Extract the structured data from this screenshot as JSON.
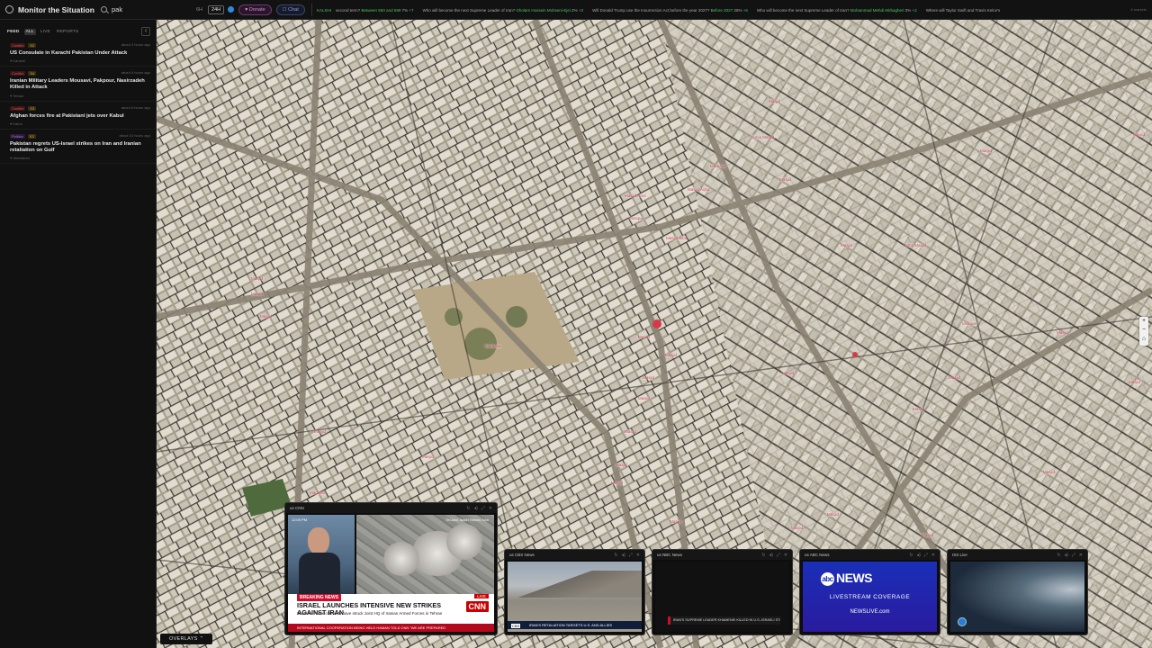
{
  "app": {
    "title": "Monitor the Situation"
  },
  "search": {
    "value": "pak",
    "placeholder": ""
  },
  "toggles": [
    {
      "label": "6H",
      "on": false
    },
    {
      "label": "24H",
      "on": true
    }
  ],
  "buttons": {
    "donate": "♥ Donate",
    "chat": "☐ Chat"
  },
  "ticker": {
    "label": "KALSHI",
    "items": [
      {
        "text": "second term?",
        "extra": "Between 550 and 599",
        "pct": "7%",
        "delta": "+7"
      },
      {
        "text": "Who will become the next Supreme Leader of Iran?",
        "extra": "Gholam Hossein Mohseni-Ejei",
        "pct": "2%",
        "delta": "+2"
      },
      {
        "text": "Will Donald Trump use the Insurrection Act before the year 2027?",
        "extra": "Before 2027",
        "pct": "28%",
        "delta": "+6"
      },
      {
        "text": "Who will become the next Supreme Leader of Iran?",
        "extra": "Mohammad Mehdi Mirbagheri",
        "pct": "3%",
        "delta": "+2"
      },
      {
        "text": "Where will Taylor Swift and Travis Kelce's",
        "extra": "",
        "pct": "",
        "delta": ""
      }
    ],
    "more": "6 markets"
  },
  "sidebar": {
    "tabs": [
      "FEED",
      "ALL",
      "LIVE",
      "REPORTS"
    ],
    "active_tab": "ALL",
    "items": [
      {
        "category": "Conflict",
        "severity": "S2",
        "time": "about 3 hours ago",
        "title": "US Consulate in Karachi Pakistan Under Attack",
        "location": "Karachi"
      },
      {
        "category": "Conflict",
        "severity": "S4",
        "time": "about 4 hours ago",
        "title": "Iranian Military Leaders Mousavi, Pakpour, Nasirzadeh Killed in Attack",
        "location": "Tehran"
      },
      {
        "category": "Conflict",
        "severity": "S3",
        "time": "about 6 hours ago",
        "title": "Afghan forces fire at Pakistani jets over Kabul",
        "location": "Kabul"
      },
      {
        "category": "Politics",
        "severity": "S3",
        "time": "about 10 hours ago",
        "title": "Pakistan regrets US-Israel strikes on Iran and Iranian retaliation on Gulf",
        "location": "Islamabad"
      }
    ]
  },
  "map": {
    "labels": [
      "Masjid",
      "Jamia Masjid",
      "Madrasa",
      "Masjid Noor",
      "Masjid Aqsa",
      "Masjid",
      "Mosque",
      "Masjid Bilal",
      "Masjid",
      "Jama Masjid",
      "Masjid",
      "Masjid",
      "Masjid",
      "Madrasa",
      "Masjid",
      "Masjid",
      "Masjid",
      "Masjid",
      "Masjid",
      "Mosque",
      "Masjid",
      "Masjid",
      "Masjid",
      "Masjid",
      "Masjid",
      "Masjid",
      "Masjid",
      "Masjid",
      "Masjid",
      "Masjid",
      "Masjid",
      "Masjid",
      "Masjid",
      "Masjid",
      "Masjid",
      "Masjid",
      "Madrasa"
    ],
    "zoom": [
      "+",
      "−",
      "⌂"
    ],
    "overlays_button": "OVERLAYS ⌃"
  },
  "videos": [
    {
      "id": "cnn",
      "title": "us CNN",
      "time": "12:09 PM",
      "loc_top": "Tel Aviv, Israel",
      "loc_right": "Tehran, Iran",
      "breaking": "BREAKING NEWS",
      "live": "LIVE",
      "headline": "ISRAEL LAUNCHES INTENSIVE NEW STRIKES AGAINST IRAN",
      "sub": "Israel Air Force claims to have struck Joint HQ of Iranian Armed Forces in Tehran",
      "crawl": "INTERNATIONAL COOPERATION BEING HELD HAMAN TOLD CNN \"WE ARE PREPARED",
      "logo": "CNN"
    },
    {
      "id": "cbs",
      "title": "us CBS News",
      "band": "IRAN'S RETALIATION TARGETS U.S. AND ALLIES",
      "logo": "CBS"
    },
    {
      "id": "nbc",
      "title": "us NBC News",
      "band": "IRAN'S SUPREME LEADER KHAMENEI KILLED IN U.S.-ISRAELI STRIKE"
    },
    {
      "id": "abc",
      "title": "us ABC News",
      "logo": "NEWS",
      "sub": "LIVESTREAM COVERAGE",
      "url": "NEWSLIVE.com"
    },
    {
      "id": "iss",
      "title": "ISS Live"
    }
  ],
  "colors": {
    "conflict": "#e05555",
    "politics": "#a07ad6",
    "accent_green": "#4fc36a",
    "map_label": "#c23a4a"
  }
}
